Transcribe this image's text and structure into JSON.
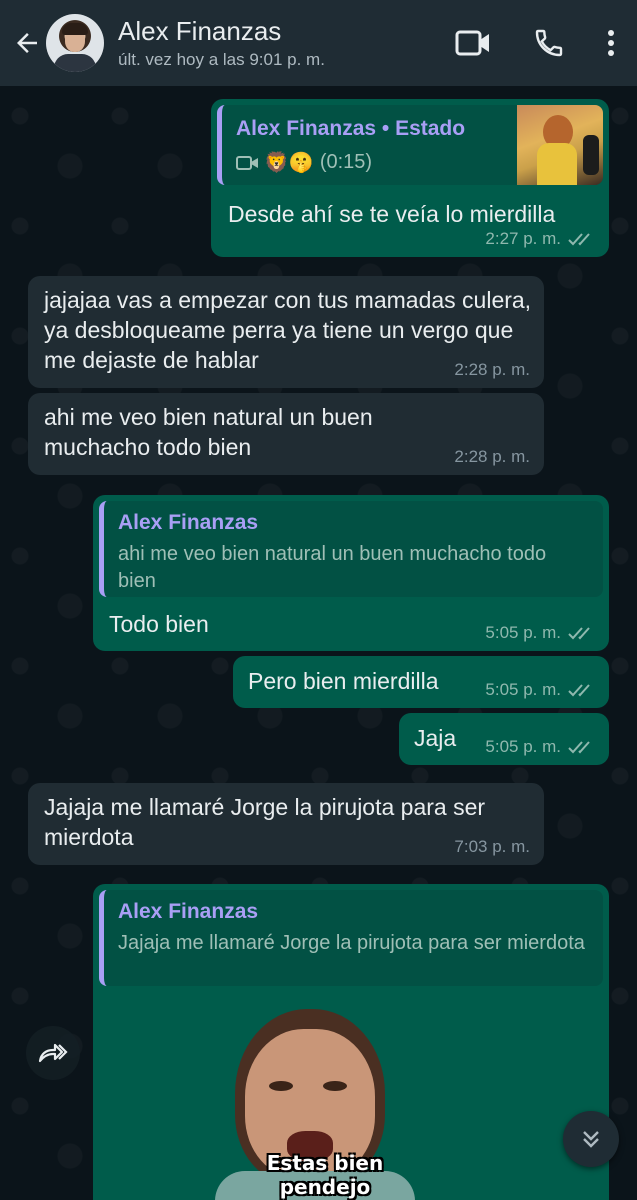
{
  "header": {
    "contact_name": "Alex Finanzas",
    "last_seen": "últ. vez hoy a las 9:01 p. m.",
    "icons": [
      "back-arrow-icon",
      "video-call-icon",
      "voice-call-icon",
      "more-options-icon"
    ]
  },
  "messages": [
    {
      "direction": "out",
      "status_reply": {
        "author": "Alex Finanzas • Estado",
        "duration": "(0:15)",
        "emojis": "🦁🤫"
      },
      "text": "Desde ahí se te veía lo mierdilla",
      "time": "2:27 p. m."
    },
    {
      "direction": "in",
      "text": "jajajaa vas a empezar con tus mamadas culera, ya desbloqueame perra ya tiene un vergo que me dejaste de hablar",
      "time": "2:28 p. m."
    },
    {
      "direction": "in",
      "text": "ahi me veo bien natural un buen muchacho todo bien",
      "time": "2:28 p. m."
    },
    {
      "direction": "out",
      "reply": {
        "author": "Alex Finanzas",
        "text": "ahi me veo bien natural un buen muchacho todo bien"
      },
      "text": "Todo bien",
      "time": "5:05 p. m."
    },
    {
      "direction": "out",
      "text": "Pero bien mierdilla",
      "time": "5:05 p. m."
    },
    {
      "direction": "out",
      "text": "Jaja",
      "time": "5:05 p. m."
    },
    {
      "direction": "in",
      "text": "Jajaja me llamaré Jorge la pirujota para ser mierdota",
      "time": "7:03 p. m."
    },
    {
      "direction": "out",
      "reply": {
        "author": "Alex Finanzas",
        "text": "Jajaja me llamaré Jorge la pirujota para ser mierdota"
      },
      "sticker_caption_line1": "Estas bien",
      "sticker_caption_line2": "pendejo"
    }
  ],
  "colors": {
    "background": "#0b141a",
    "header": "#1f2c34",
    "outgoing_bubble": "#005c4b",
    "incoming_bubble": "#202c33",
    "reply_accent": "#a99ff5",
    "read_ticks": "#8fb8ae"
  }
}
